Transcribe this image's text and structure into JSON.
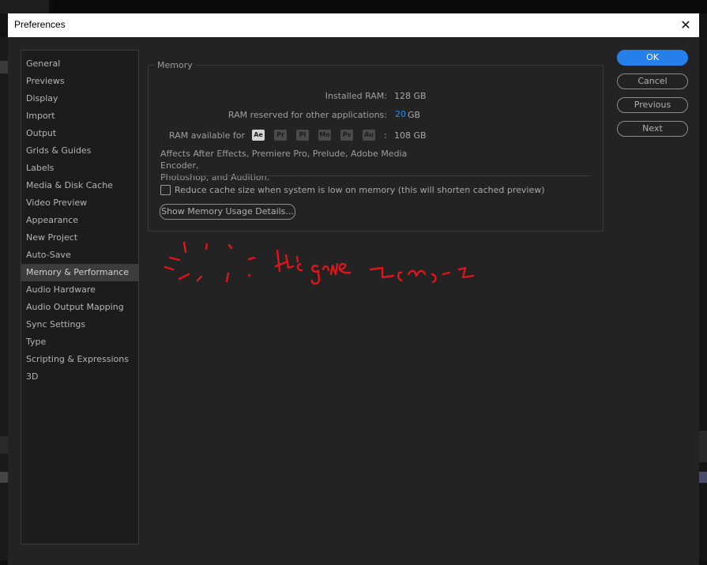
{
  "dialog": {
    "title": "Preferences",
    "close_glyph": "✕"
  },
  "sidebar": {
    "items": [
      {
        "label": "General"
      },
      {
        "label": "Previews"
      },
      {
        "label": "Display"
      },
      {
        "label": "Import"
      },
      {
        "label": "Output"
      },
      {
        "label": "Grids & Guides"
      },
      {
        "label": "Labels"
      },
      {
        "label": "Media & Disk Cache"
      },
      {
        "label": "Video Preview"
      },
      {
        "label": "Appearance"
      },
      {
        "label": "New Project"
      },
      {
        "label": "Auto-Save"
      },
      {
        "label": "Memory & Performance",
        "selected": true
      },
      {
        "label": "Audio Hardware"
      },
      {
        "label": "Audio Output Mapping"
      },
      {
        "label": "Sync Settings"
      },
      {
        "label": "Type"
      },
      {
        "label": "Scripting & Expressions"
      },
      {
        "label": "3D"
      }
    ]
  },
  "memory": {
    "group_title": "Memory",
    "installed_label": "Installed RAM:",
    "installed_value": "128 GB",
    "reserved_label": "RAM reserved for other applications:",
    "reserved_value": "20",
    "reserved_unit": "GB",
    "available_label": "RAM available for",
    "apps": [
      "Ae",
      "Pr",
      "Pl",
      "Me",
      "Ps",
      "Au"
    ],
    "available_sep": ":",
    "available_value": "108 GB",
    "description": "Affects After Effects, Premiere Pro, Prelude, Adobe Media Encoder,",
    "description_line2": "Photoshop, and Audition.",
    "checkbox_label": "Reduce cache size when system is low on memory (this will shorten cached preview)",
    "checkbox_checked": false,
    "details_button": "Show Memory Usage Details..."
  },
  "buttons": {
    "ok": "OK",
    "cancel": "Cancel",
    "previous": "Previous",
    "next": "Next"
  },
  "annotation": {
    "handwritten_text": "It's gone ¯\\_(ツ)_/¯",
    "color": "#e0141c"
  },
  "colors": {
    "accent": "#2680eb",
    "value_blue": "#2d8ceb"
  }
}
